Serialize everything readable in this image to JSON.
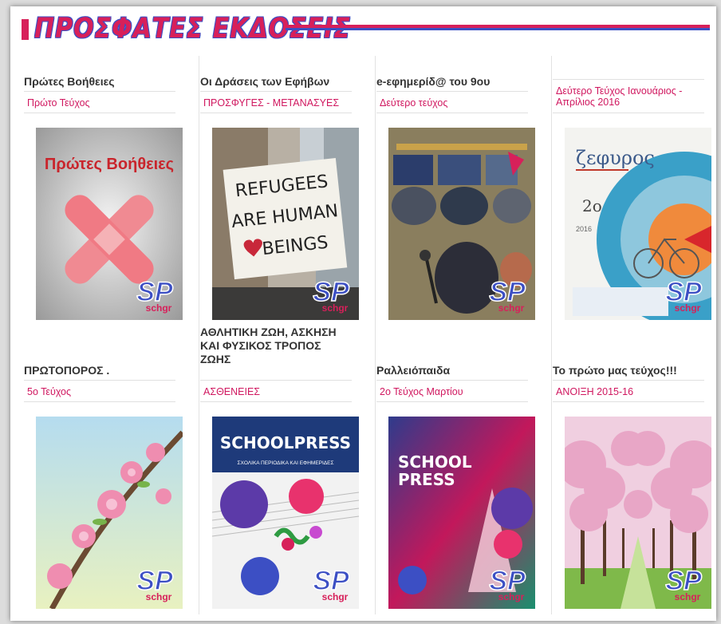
{
  "header": {
    "title": "ΠΡΟΣΦΑΤΕΣ ΕΚΔΟΣΕΙΣ"
  },
  "publications": [
    {
      "title": "Πρώτες Βοήθειες",
      "issue": "Πρώτο Τεύχος",
      "cover_text": "Πρώτες Βοήθειες"
    },
    {
      "title": "Οι Δράσεις των Εφήβων",
      "issue": "ΠΡΟΣΦΥΓΕΣ - ΜΕΤΑΝΑΣΥΕΣ",
      "cover_text": "REFUGEES ARE HUMAN BEINGS"
    },
    {
      "title": "e-εφημερίδ@ του 9ου",
      "issue": "Δεύτερο τεύχος"
    },
    {
      "title": "",
      "issue": "Δεύτερο Τεύχος Ιανουάριος - Απρίλιος 2016",
      "cover_text": "ζεφυρος"
    },
    {
      "title": "ΠΡΩΤΟΠΟΡΟΣ .",
      "issue": "5ο Τεύχος"
    },
    {
      "title": "ΑΘΛΗΤΙΚΗ ΖΩΗ, ΑΣΚΗΣΗ ΚΑΙ ΦΥΣΙΚΟΣ ΤΡΟΠΟΣ ΖΩΗΣ",
      "issue": "ΑΣΘΕΝΕΙΕΣ",
      "cover_text": "SCHOOLPRESS",
      "cover_subtext": "ΣΧΟΛΙΚΑ ΠΕΡΙΟΔΙΚΑ ΚΑΙ ΕΦΗΜΕΡΙΔΕΣ"
    },
    {
      "title": "Ραλλειόπαιδα",
      "issue": "2ο Τεύχος Μαρτίου",
      "cover_text": "SCHOOL PRESS"
    },
    {
      "title": "Το πρώτο μας τεύχος!!!",
      "issue": "ΑΝΟΙΞΗ 2015-16"
    }
  ],
  "logo": {
    "text": "SP",
    "subtext": "schgr"
  },
  "colors": {
    "accent": "#d7205a",
    "accent2": "#3c4fc4",
    "link": "#d0175f"
  }
}
